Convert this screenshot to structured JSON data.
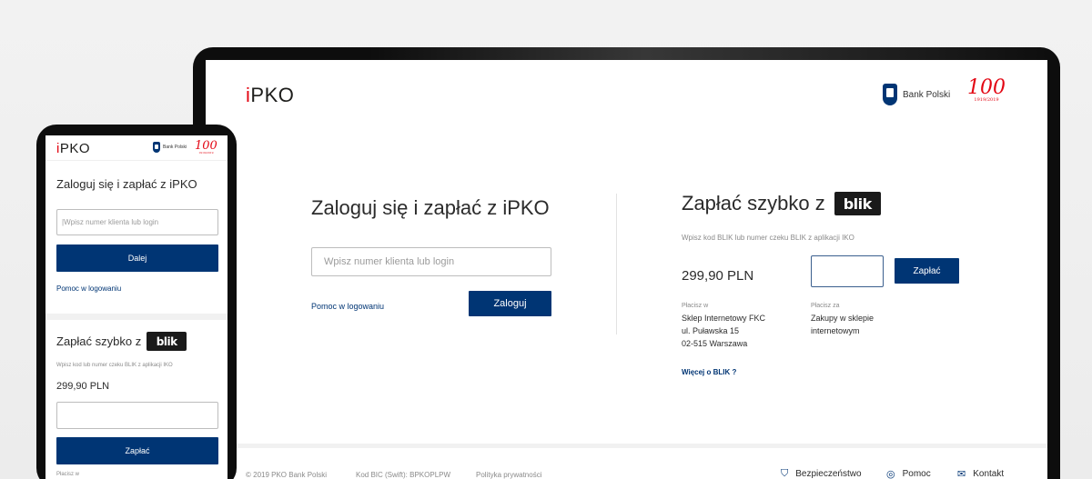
{
  "desktop": {
    "header": {
      "logo_i": "i",
      "logo_rest": "PKO",
      "bank_name": "Bank Polski",
      "anniversary": "100",
      "anniversary_years": "1919/2019"
    },
    "login": {
      "title": "Zaloguj się i zapłać z iPKO",
      "input_placeholder": "Wpisz numer klienta lub login",
      "help_link": "Pomoc w logowaniu",
      "login_button": "Zaloguj"
    },
    "blik": {
      "title": "Zapłać szybko z",
      "badge_text": "blik",
      "subtitle": "Wpisz kod BLIK lub numer czeku BLIK z aplikacji IKO",
      "amount": "299,90 PLN",
      "pay_button": "Zapłać",
      "payee_label": "Płacisz w",
      "payee_lines": [
        "Sklep Internetowy FKC",
        "ul. Puławska 15",
        "02-515 Warszawa"
      ],
      "for_label": "Płacisz za",
      "for_lines": [
        "Zakupy w sklepie",
        "internetowym"
      ],
      "more_link": "Więcej o BLIK ?"
    },
    "footer": {
      "copyright": "© 2019 PKO Bank Polski",
      "bic": "Kod BIC (Swift): BPKOPLPW",
      "privacy": "Polityka prywatności",
      "security": "Bezpieczeństwo",
      "help": "Pomoc",
      "contact": "Kontakt"
    }
  },
  "mobile": {
    "header": {
      "logo_i": "i",
      "logo_rest": "PKO",
      "bank_name": "Bank Polski",
      "anniversary": "100",
      "anniversary_years": "1919/2019"
    },
    "login": {
      "title": "Zaloguj się i zapłać z iPKO",
      "input_placeholder": "|Wpisz numer klienta lub login",
      "next_button": "Dalej",
      "help_link": "Pomoc w logowaniu"
    },
    "blik": {
      "title": "Zapłać szybko z",
      "badge_text": "blik",
      "subtitle": "Wpisz kod lub numer czeku BLIK z aplikacji IKO",
      "amount": "299,90 PLN",
      "pay_button": "Zapłać",
      "payee_label": "Płacisz w"
    }
  },
  "colors": {
    "brand_navy": "#003574",
    "brand_red": "#e30613",
    "device_frame": "#0d0d0d"
  },
  "icons": [
    "shield-icon",
    "help-circle-icon",
    "mail-icon",
    "pko-emblem-icon"
  ]
}
